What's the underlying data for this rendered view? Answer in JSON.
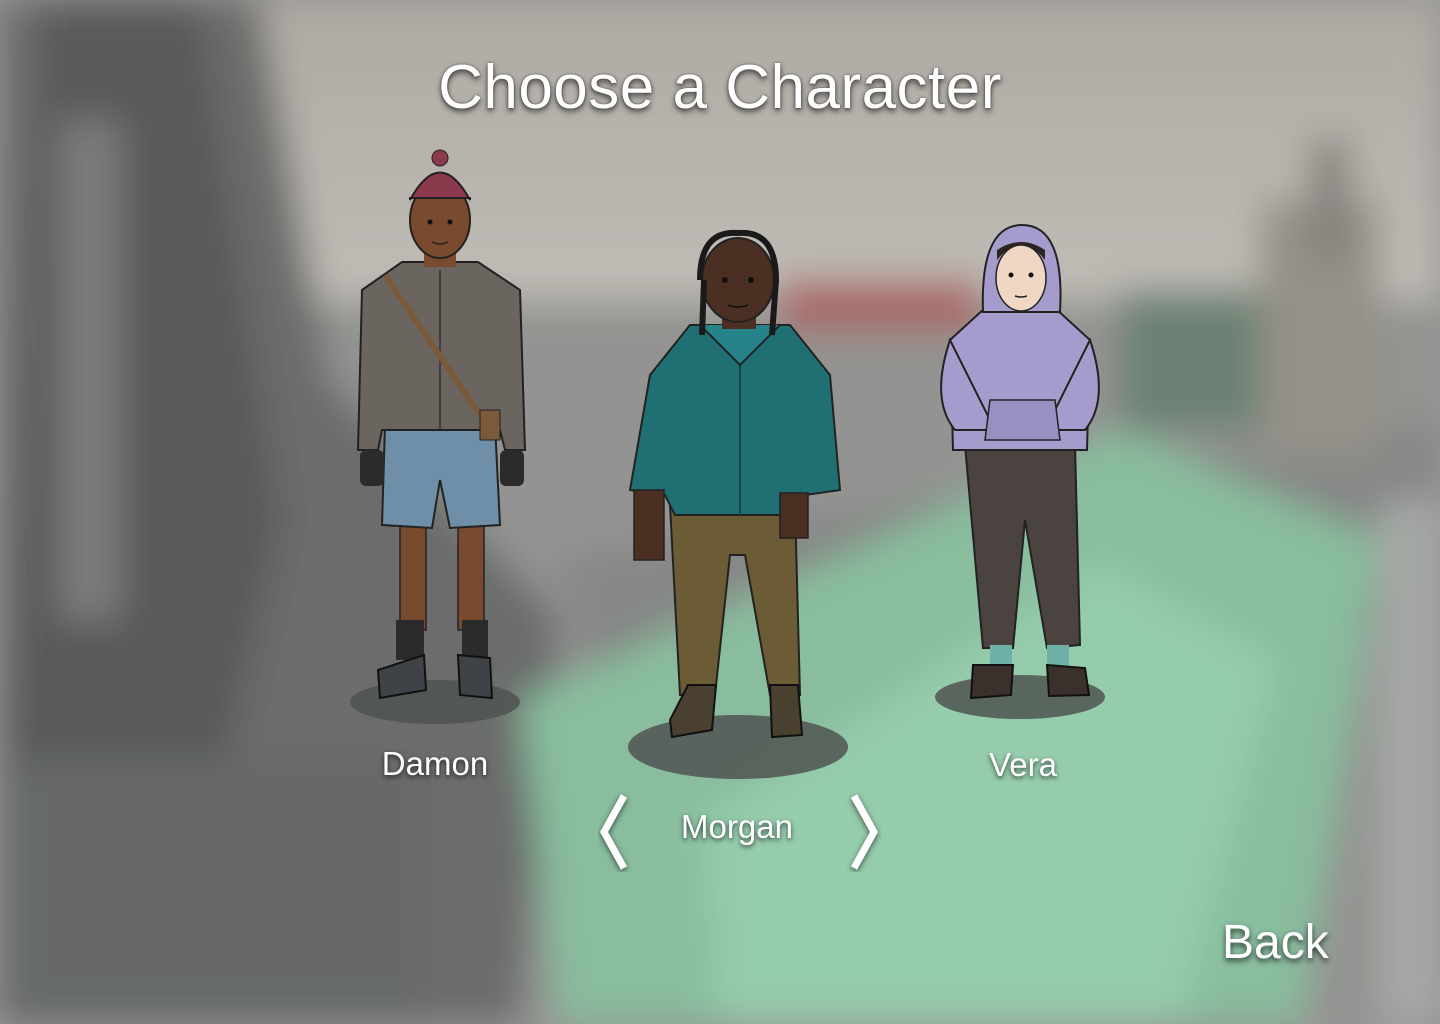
{
  "title": "Choose a Character",
  "characters": [
    {
      "name": "Damon",
      "selected": false,
      "shirt_color": "#6b6560",
      "shorts_color": "#6f8fa8",
      "skin_color": "#7a4a2e",
      "hat_color": "#8a3a4c"
    },
    {
      "name": "Morgan",
      "selected": true,
      "shirt_color": "#1f6f73",
      "pants_color": "#6b5c35",
      "skin_color": "#4a2f22"
    },
    {
      "name": "Vera",
      "selected": false,
      "hoodie_color": "#a59ccd",
      "pants_color": "#4a4340",
      "skin_color": "#f0d7c4"
    }
  ],
  "selected_name": "Morgan",
  "nav": {
    "prev_icon": "chevron-left-icon",
    "next_icon": "chevron-right-icon"
  },
  "back_label": "Back",
  "colors": {
    "text": "#ffffff",
    "grass": "#7fc29a",
    "sky": "#b7b3ad",
    "shadow": "#4f5450"
  }
}
